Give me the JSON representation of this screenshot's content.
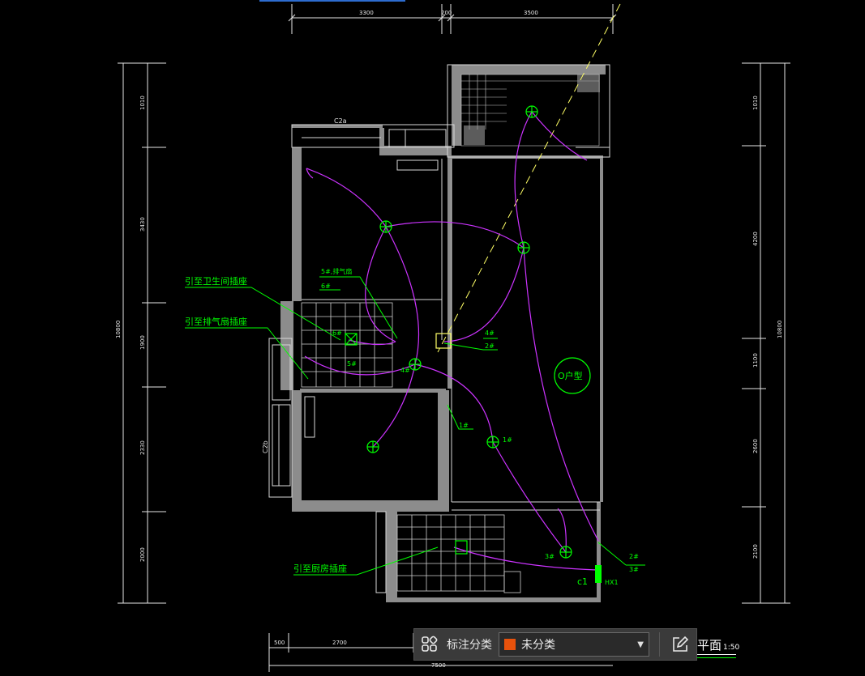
{
  "dimensions": {
    "top": [
      "3300",
      "200",
      "3500"
    ],
    "left": [
      "1010",
      "3430",
      "1900",
      "2330",
      "2000"
    ],
    "left_total": "10800",
    "right": [
      "1010",
      "4200",
      "1100",
      "2600",
      "2100"
    ],
    "right_total": "10800",
    "bottom": [
      "500",
      "2700"
    ],
    "bottom_total": "7500"
  },
  "labels": {
    "to_bathroom_socket": "引至卫生间插座",
    "to_exhaust_socket": "引至排气扇插座",
    "to_kitchen_socket": "引至厨房插座",
    "unit_type": "O户型",
    "box_id": "HX1",
    "box_circuit": "c1",
    "window_c2a": "C2a",
    "window_c2b": "C2b",
    "exhaust_tag": "5#,排气扇",
    "circuit_1": "1#",
    "circuit_2": "2#",
    "circuit_3": "3#",
    "circuit_4": "4#",
    "circuit_5": "5#",
    "circuit_6": "6#"
  },
  "toolbar": {
    "icon_left": "grid-apps-icon",
    "label": "标注分类",
    "selected": "未分类",
    "swatch_color": "#e8520c",
    "icon_right": "edit-icon"
  },
  "title": {
    "name": "平面",
    "scale": "1:50"
  },
  "colors": {
    "wall": "#8c8c8c",
    "wiring": "#cc33ff",
    "annotation": "#00ff00",
    "axis": "#ffff66",
    "line": "#e6e6e6"
  }
}
